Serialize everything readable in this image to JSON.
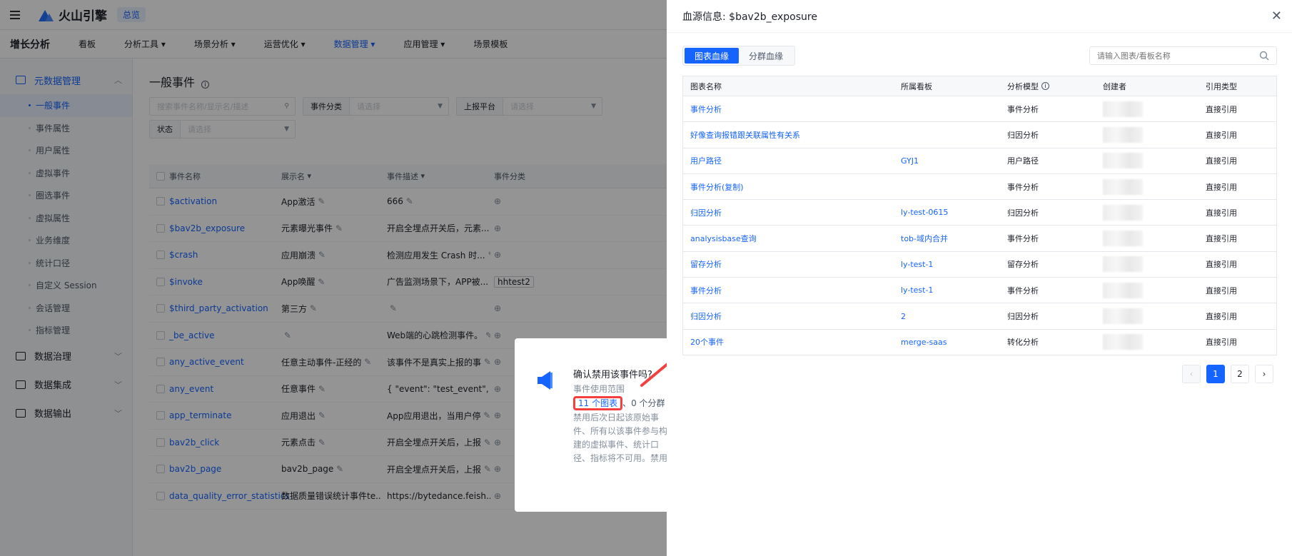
{
  "topbar": {
    "logo_text": "火山引擎",
    "home_chip": "总览"
  },
  "navbar": {
    "brand": "增长分析",
    "items": [
      "看板",
      "分析工具",
      "场景分析",
      "运营优化",
      "数据管理",
      "应用管理",
      "场景模板"
    ],
    "dropdown_items": [
      false,
      true,
      true,
      true,
      true,
      true,
      false
    ],
    "active_index": 4
  },
  "sidebar": {
    "section1": "元数据管理",
    "items": [
      "一般事件",
      "事件属性",
      "用户属性",
      "虚拟事件",
      "圈选事件",
      "虚拟属性",
      "业务维度",
      "统计口径",
      "自定义 Session",
      "会话管理",
      "指标管理"
    ],
    "active_index": 0,
    "sections": [
      "数据治理",
      "数据集成",
      "数据输出"
    ]
  },
  "main": {
    "title": "一般事件",
    "search_placeholder": "搜索事件名称/显示名/描述",
    "filter_category_label": "事件分类",
    "filter_category_placeholder": "请选择",
    "filter_platform_label": "上报平台",
    "filter_platform_placeholder": "请选择",
    "filter_status_label": "状态",
    "filter_status_placeholder": "请选择",
    "columns": [
      "事件名称",
      "展示名",
      "事件描述",
      "事件分类"
    ],
    "rows": [
      {
        "name": "$activation",
        "display": "App激活",
        "desc": "666",
        "category": ""
      },
      {
        "name": "$bav2b_exposure",
        "display": "元素曝光事件",
        "desc": "开启全埋点开关后，元素...",
        "category": ""
      },
      {
        "name": "$crash",
        "display": "应用崩溃",
        "desc": "检测应用发生 Crash 时...",
        "category": ""
      },
      {
        "name": "$invoke",
        "display": "App唤醒",
        "desc": "广告监测场景下，APP被...",
        "category": "hhtest2"
      },
      {
        "name": "$third_party_activation",
        "display": "第三方",
        "desc": "",
        "category": ""
      },
      {
        "name": "_be_active",
        "display": "",
        "desc": "Web端的心跳检测事件。",
        "category": ""
      },
      {
        "name": "any_active_event",
        "display": "任意主动事件-正经的",
        "desc": "该事件不是真实上报的事",
        "category": ""
      },
      {
        "name": "any_event",
        "display": "任意事件",
        "desc": "{ \"event\": \"test_event\",",
        "category": ""
      },
      {
        "name": "app_terminate",
        "display": "应用退出",
        "desc": "App应用退出，当用户停",
        "category": ""
      },
      {
        "name": "bav2b_click",
        "display": "元素点击",
        "desc": "开启全埋点开关后，上报",
        "category": ""
      },
      {
        "name": "bav2b_page",
        "display": "bav2b_page",
        "desc": "开启全埋点开关后，上报",
        "category": ""
      },
      {
        "name": "data_quality_error_statistics",
        "display": "数据质量错误统计事件te...",
        "desc": "https://bytedance.feish...",
        "category": ""
      }
    ]
  },
  "confirm": {
    "title": "确认禁用该事件吗?",
    "scope": "事件使用范围",
    "charts_link": "11 个图表",
    "groups_text": "、0 个分群",
    "description": "禁用后次日起该原始事件、所有以该事件参与构建的虚拟事件、统计口径、指标将不可用。禁用事件一般用于不再上报的事件。"
  },
  "drawer": {
    "title": "血源信息: $bav2b_exposure",
    "tabs": [
      "图表血缘",
      "分群血缘"
    ],
    "active_tab": 0,
    "search_placeholder": "请输入图表/看板名称",
    "columns": [
      "图表名称",
      "所属看板",
      "分析模型",
      "创建者",
      "引用类型"
    ],
    "rows": [
      {
        "chart": "事件分析",
        "board": "",
        "model": "事件分析",
        "ref": "直接引用"
      },
      {
        "chart": "好像查询报错跟关联属性有关系",
        "board": "",
        "model": "归因分析",
        "ref": "直接引用"
      },
      {
        "chart": "用户路径",
        "board": "GYJ1",
        "model": "用户路径",
        "ref": "直接引用"
      },
      {
        "chart": "事件分析(复制)",
        "board": "",
        "model": "事件分析",
        "ref": "直接引用"
      },
      {
        "chart": "归因分析",
        "board": "ly-test-0615",
        "model": "归因分析",
        "ref": "直接引用"
      },
      {
        "chart": "analysisbase查询",
        "board": "tob-域内合并",
        "model": "事件分析",
        "ref": "直接引用"
      },
      {
        "chart": "留存分析",
        "board": "ly-test-1",
        "model": "留存分析",
        "ref": "直接引用"
      },
      {
        "chart": "事件分析",
        "board": "ly-test-1",
        "model": "事件分析",
        "ref": "直接引用"
      },
      {
        "chart": "归因分析",
        "board": "2",
        "model": "归因分析",
        "ref": "直接引用"
      },
      {
        "chart": "20个事件",
        "board": "merge-saas",
        "model": "转化分析",
        "ref": "直接引用"
      }
    ],
    "pagination": {
      "prev": "‹",
      "pages": [
        "1",
        "2"
      ],
      "next": "›",
      "current": "1"
    }
  },
  "colors": {
    "primary": "#1664ff",
    "highlight": "#f53f3f",
    "overlay": "rgba(0,0,0,0.42)"
  },
  "icons": [
    "hamburger-icon",
    "search-icon",
    "close-icon",
    "edit-icon",
    "filter-icon",
    "info-icon",
    "megaphone-icon",
    "chevron-down-icon"
  ]
}
